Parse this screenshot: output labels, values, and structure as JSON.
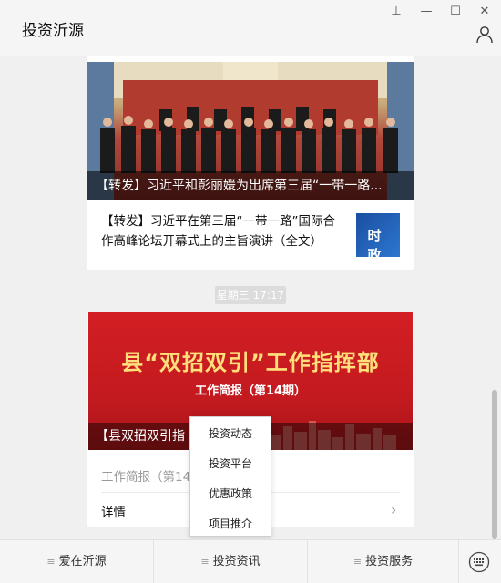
{
  "window": {
    "title": "投资沂源",
    "controls": {
      "pin": "⊥",
      "minimize": "—",
      "maximize": "☐",
      "close": "✕"
    },
    "user_icon": "user-icon"
  },
  "feed": {
    "card1": {
      "image_caption": "【转发】习近平和彭丽媛为出席第三届“一带一路...",
      "title": "【转发】习近平在第三届“一带一路”国际合作高峰论坛开幕式上的主旨演讲（全文）",
      "thumb_text": "时 政"
    },
    "timestamp": "星期三 17:17",
    "card2": {
      "banner_title": "县“双招双引”工作指挥部",
      "banner_subtitle": "工作简报（第14期）",
      "image_caption": "【县双招双引指",
      "description": "工作简报（第14",
      "detail_label": "详情",
      "chevron": "›"
    }
  },
  "popup_menu": {
    "items": [
      "投资动态",
      "投资平台",
      "优惠政策",
      "项目推介"
    ]
  },
  "bottom_menu": {
    "tabs": [
      "爱在沂源",
      "投资资讯",
      "投资服务"
    ],
    "menu_glyph": "≡",
    "keyboard_icon": "keyboard-icon"
  },
  "colors": {
    "banner_red": "#c41a1f",
    "banner_title_yellow": "#ffe07a",
    "background": "#f0f0f0"
  }
}
